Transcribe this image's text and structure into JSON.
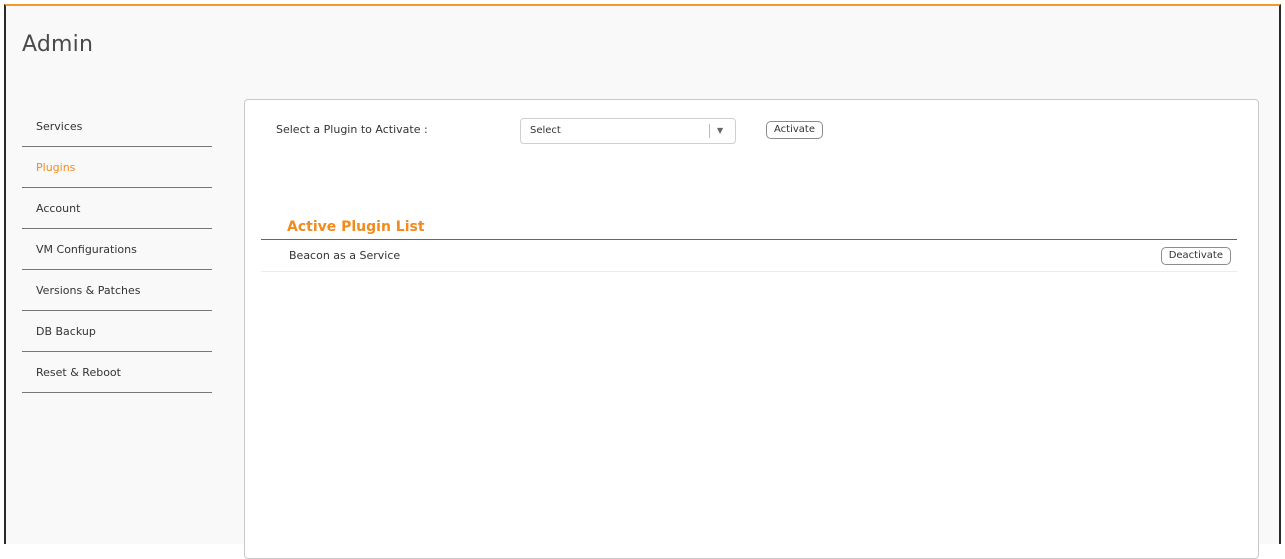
{
  "page": {
    "title": "Admin"
  },
  "sidebar": {
    "items": [
      {
        "label": "Services",
        "active": false
      },
      {
        "label": "Plugins",
        "active": true
      },
      {
        "label": "Account",
        "active": false
      },
      {
        "label": "VM Configurations",
        "active": false
      },
      {
        "label": "Versions & Patches",
        "active": false
      },
      {
        "label": "DB Backup",
        "active": false
      },
      {
        "label": "Reset & Reboot",
        "active": false
      }
    ]
  },
  "main": {
    "select_label": "Select a Plugin to Activate :",
    "select_value": "Select",
    "activate_label": "Activate",
    "section_title": "Active Plugin List",
    "plugins": [
      {
        "name": "Beacon as a Service",
        "action_label": "Deactivate"
      }
    ]
  },
  "colors": {
    "accent": "#f28a1e",
    "top_border": "#f29b2b"
  },
  "icons": {
    "select_caret": "caret-down-icon"
  }
}
